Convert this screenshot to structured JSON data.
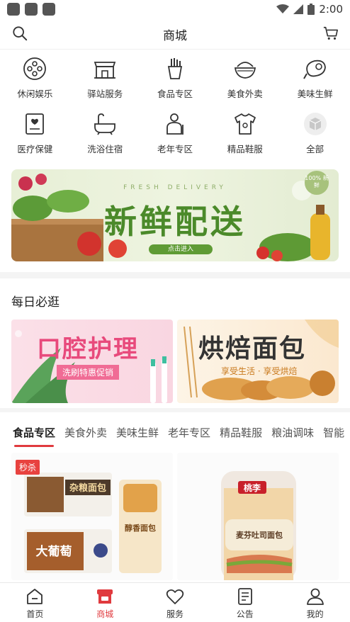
{
  "status_bar": {
    "time": "2:00"
  },
  "header": {
    "title": "商城"
  },
  "categories": [
    {
      "label": "休闲娱乐",
      "icon": "film-reel-icon"
    },
    {
      "label": "驿站服务",
      "icon": "storefront-icon"
    },
    {
      "label": "食品专区",
      "icon": "fries-icon"
    },
    {
      "label": "美食外卖",
      "icon": "rice-bowl-icon"
    },
    {
      "label": "美味生鲜",
      "icon": "meat-icon"
    },
    {
      "label": "医疗保健",
      "icon": "medical-card-icon"
    },
    {
      "label": "洗浴住宿",
      "icon": "bathtub-icon"
    },
    {
      "label": "老年专区",
      "icon": "elderly-icon"
    },
    {
      "label": "精品鞋服",
      "icon": "tshirt-icon"
    },
    {
      "label": "全部",
      "icon": "cube-icon"
    }
  ],
  "banner": {
    "subtitle_en": "FRESH DELIVERY",
    "title": "新鲜配送",
    "cta": "点击进入",
    "badge": "100% 新鲜"
  },
  "daily": {
    "title": "每日必逛",
    "promos": [
      {
        "title": "口腔护理",
        "subtitle": "洗刷特惠促销"
      },
      {
        "title": "烘焙面包",
        "subtitle": "享受生活 · 享受烘焙"
      }
    ]
  },
  "tabs": [
    "食品专区",
    "美食外卖",
    "美味生鲜",
    "老年专区",
    "精品鞋服",
    "粮油调味",
    "智能"
  ],
  "products": [
    {
      "badge": "秒杀",
      "text_1": "杂粮面包",
      "text_2": "大葡萄",
      "text_3": "醇香面包"
    },
    {
      "badge": "",
      "text_1": "桃李",
      "text_2": "麦芬吐司面包"
    }
  ],
  "bottom_nav": [
    {
      "label": "首页",
      "icon": "home-icon"
    },
    {
      "label": "商城",
      "icon": "shop-icon"
    },
    {
      "label": "服务",
      "icon": "heart-icon"
    },
    {
      "label": "公告",
      "icon": "notice-icon"
    },
    {
      "label": "我的",
      "icon": "user-icon"
    }
  ],
  "colors": {
    "accent": "#e03a3e",
    "banner_green": "#4b8a2a"
  }
}
